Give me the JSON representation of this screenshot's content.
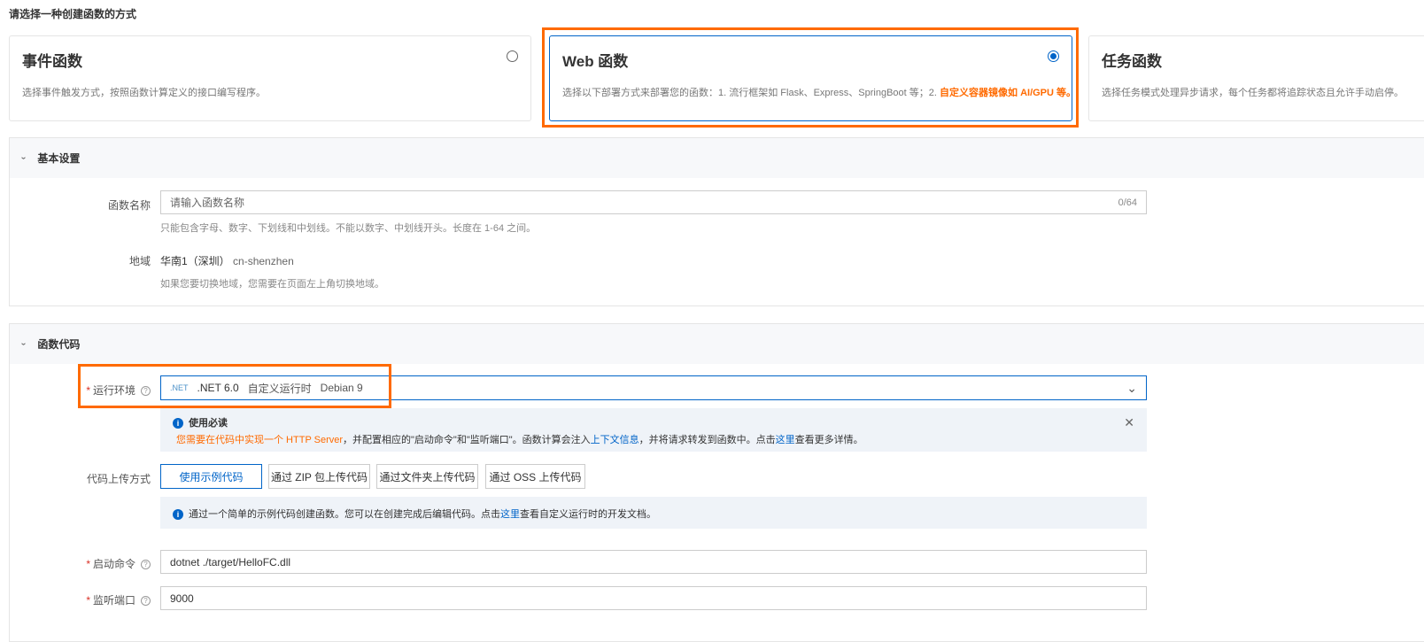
{
  "prompt": "请选择一种创建函数的方式",
  "cards": [
    {
      "title": "事件函数",
      "desc": "选择事件触发方式，按照函数计算定义的接口编写程序。",
      "selected": false
    },
    {
      "title": "Web 函数",
      "desc": "选择以下部署方式来部署您的函数：1. 流行框架如 Flask、Express、SpringBoot 等；2. ",
      "desc_highlight": "自定义容器镜像如 AI/GPU 等。",
      "selected": true
    },
    {
      "title": "任务函数",
      "desc": "选择任务模式处理异步请求，每个任务都将追踪状态且允许手动启停。",
      "selected": false
    }
  ],
  "basic": {
    "title": "基本设置",
    "name_label": "函数名称",
    "name_placeholder": "请输入函数名称",
    "name_count": "0/64",
    "name_hint": "只能包含字母、数字、下划线和中划线。不能以数字、中划线开头。长度在 1-64 之间。",
    "region_label": "地域",
    "region_value": "华南1（深圳）",
    "region_code": "cn-shenzhen",
    "region_hint": "如果您要切换地域，您需要在页面左上角切换地域。"
  },
  "code": {
    "title": "函数代码",
    "runtime_label": "运行环境",
    "runtime_logo": ".NET",
    "runtime_name": ".NET 6.0",
    "runtime_type": "自定义运行时",
    "runtime_os": "Debian 9",
    "notice_title": "使用必读",
    "notice_orange": "您需要在代码中实现一个 HTTP Server",
    "notice_1": "，并配置相应的\"启动命令\"和\"监听端口\"。函数计算会注入",
    "notice_link1": "上下文信息",
    "notice_2": "，并将请求转发到函数中。点击",
    "notice_link2": "这里",
    "notice_3": "查看更多详情。",
    "upload_label": "代码上传方式",
    "upload_options": [
      "使用示例代码",
      "通过 ZIP 包上传代码",
      "通过文件夹上传代码",
      "通过 OSS 上传代码"
    ],
    "tip_1": "通过一个简单的示例代码创建函数。您可以在创建完成后编辑代码。点击",
    "tip_link": "这里",
    "tip_2": "查看自定义运行时的开发文档。",
    "cmd_label": "启动命令",
    "cmd_value": "dotnet ./target/HelloFC.dll",
    "port_label": "监听端口",
    "port_value": "9000"
  }
}
